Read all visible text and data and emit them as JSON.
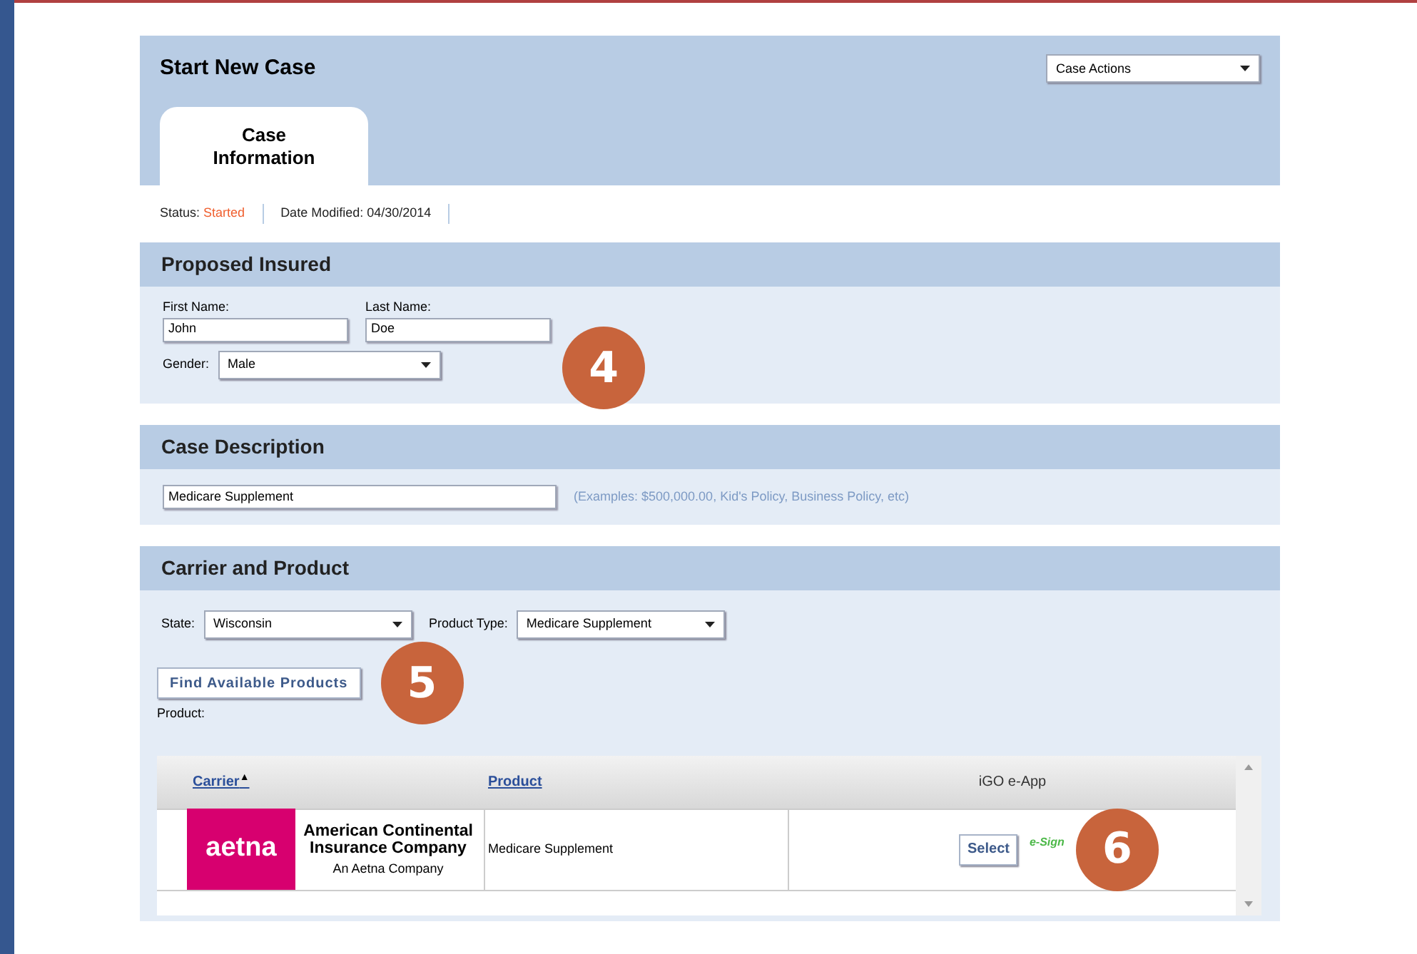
{
  "header": {
    "title": "Start New Case",
    "actions_dropdown": "Case Actions"
  },
  "tabs": [
    {
      "label": "Case Information",
      "selected": true
    }
  ],
  "status": {
    "label": "Status:",
    "value": "Started",
    "date_label": "Date Modified:",
    "date": "04/30/2014"
  },
  "proposed_insured": {
    "title": "Proposed Insured",
    "first_name_label": "First Name:",
    "first_name": "John",
    "last_name_label": "Last Name:",
    "last_name": "Doe",
    "gender_label": "Gender:",
    "gender": "Male",
    "callout": "4"
  },
  "case_description": {
    "title": "Case Description",
    "value": "Medicare Supplement",
    "hint": "(Examples: $500,000.00, Kid's Policy, Business Policy, etc)"
  },
  "carrier_and_product": {
    "title": "Carrier and Product",
    "state_label": "State:",
    "state": "Wisconsin",
    "product_type_label": "Product Type:",
    "product_type": "Medicare Supplement",
    "find_button": "Find Available Products",
    "callout_find": "5",
    "product_label": "Product:",
    "table": {
      "columns": [
        {
          "label": "Carrier",
          "sort": "▲",
          "link": true
        },
        {
          "label": "Product",
          "link": true
        },
        {
          "label": "iGO e-App",
          "link": false
        }
      ],
      "rows": [
        {
          "logo": "aetna",
          "carrier_name": "American Continental Insurance Company",
          "carrier_sub": "An Aetna Company",
          "product": "Medicare Supplement",
          "button": "Select",
          "esign": "e-Sign",
          "callout": "6"
        }
      ]
    }
  }
}
